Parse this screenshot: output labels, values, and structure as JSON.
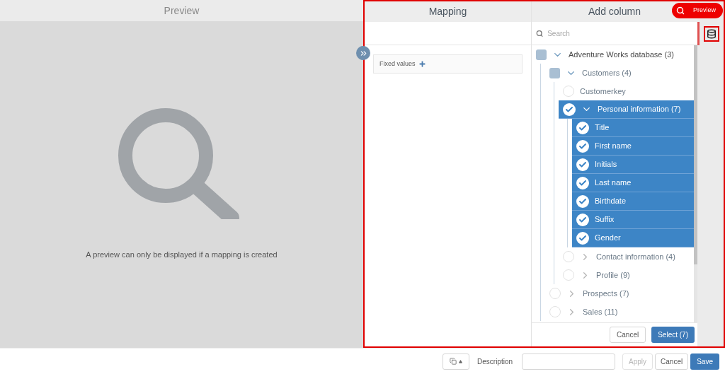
{
  "preview": {
    "title": "Preview",
    "message": "A preview can only be displayed if a mapping is created"
  },
  "mapping": {
    "title": "Mapping",
    "fixed_values": "Fixed values"
  },
  "add_column": {
    "title": "Add column",
    "search": {
      "placeholder": "Search"
    },
    "preview_button": "Preview",
    "tree": [
      {
        "kind": "group",
        "label": "Adventure Works database (3)",
        "checked": false,
        "partial": true,
        "expanded": true,
        "children": [
          {
            "kind": "group",
            "label": "Customers (4)",
            "checked": false,
            "partial": true,
            "expanded": true,
            "children": [
              {
                "kind": "field",
                "label": "Customerkey",
                "checked": false
              },
              {
                "kind": "group",
                "label": "Personal information (7)",
                "checked": true,
                "expanded": true,
                "children": [
                  {
                    "kind": "field",
                    "label": "Title",
                    "checked": true
                  },
                  {
                    "kind": "field",
                    "label": "First name",
                    "checked": true
                  },
                  {
                    "kind": "field",
                    "label": "Initials",
                    "checked": true
                  },
                  {
                    "kind": "field",
                    "label": "Last name",
                    "checked": true
                  },
                  {
                    "kind": "field",
                    "label": "Birthdate",
                    "checked": true
                  },
                  {
                    "kind": "field",
                    "label": "Suffix",
                    "checked": true
                  },
                  {
                    "kind": "field",
                    "label": "Gender",
                    "checked": true
                  }
                ]
              },
              {
                "kind": "group",
                "label": "Contact information (4)",
                "checked": false,
                "expanded": false
              },
              {
                "kind": "group",
                "label": "Profile (9)",
                "checked": false,
                "expanded": false
              }
            ]
          },
          {
            "kind": "group",
            "label": "Prospects (7)",
            "checked": false,
            "expanded": false
          },
          {
            "kind": "group",
            "label": "Sales (11)",
            "checked": false,
            "expanded": false
          }
        ]
      }
    ],
    "buttons": {
      "cancel": "Cancel",
      "select": "Select (7)"
    }
  },
  "footer": {
    "description_label": "Description",
    "apply": "Apply",
    "apply_disabled": true,
    "cancel": "Cancel",
    "save": "Save"
  }
}
